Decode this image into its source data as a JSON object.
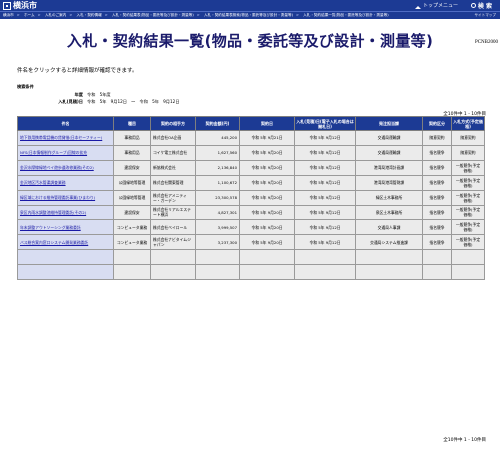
{
  "header": {
    "logo_text": "横浜市",
    "menu_label": "トップメニュー",
    "search_label": "検 索",
    "breadcrumb": [
      "横浜市",
      "ホーム",
      "入札のご案内",
      "入札・契約情報",
      "入札・契約結果表(物品・委託等及び設計・測量等)",
      "入札・契約結果表検索(物品・委託等及び設計・測量等)",
      "入札・契約結果一覧(物品・委託等及び設計・測量等)"
    ],
    "sitemap_label": "サイトマップ"
  },
  "page": {
    "title": "入札・契約結果一覧(物品・委託等及び設計・測量等)",
    "id": "PCNB2000",
    "hint": "件名をクリックすると詳細情報が確認できます。"
  },
  "conditions": {
    "title": "検索条件",
    "rows": [
      {
        "label": "年度",
        "value": "令和　5年度"
      },
      {
        "label": "入札(見積)日",
        "value": "令和　5年　9月12日　～　令和　5年　9月12日"
      }
    ]
  },
  "count_label": "全10件中 1 - 10件目",
  "table": {
    "headers": [
      "件名",
      "種目",
      "契約の相手方",
      "契約金額(円)",
      "契約日",
      "入札(見積)日(電子入札の場合は開札日)",
      "発注担当課",
      "契約区分",
      "入札方式(予定価格)"
    ],
    "rows": [
      {
        "name": "地下鉄用携帯電話機の賃貸借(日本セーフティー)",
        "category": "事務用品",
        "party": "株式会社OA企画",
        "amount": "445,200",
        "contract_date": "令和 5年 9月21日",
        "bid_date": "令和 5年 9月12日",
        "dept": "交通局運輸課",
        "kind": "随意契約",
        "method": "随意契約"
      },
      {
        "name": "NFS(日本情報制作グループ)回線の拡充",
        "category": "事務用品",
        "party": "コイケ電工株式会社",
        "amount": "1,627,560",
        "contract_date": "令和 5年 9月20日",
        "bid_date": "令和 5年 9月12日",
        "dept": "交通局運輸課",
        "kind": "指名競争",
        "method": "随意契約"
      },
      {
        "name": "金沢水際線緑地ベイ遊歩道改修業務(その2)",
        "category": "建設保安",
        "party": "新協株式会社",
        "amount": "2,136,840",
        "contract_date": "令和 5年 9月20日",
        "bid_date": "令和 5年 9月12日",
        "dept": "港湾局港湾計画課",
        "kind": "指名競争",
        "method": "一般競争(予定価格)"
      },
      {
        "name": "金沢地区汚水管渠調査業務",
        "category": "公園緑地等管理",
        "party": "株式会社関東管理",
        "amount": "1,100,672",
        "contract_date": "令和 5年 9月20日",
        "bid_date": "令和 5年 9月12日",
        "dept": "港湾局港湾管財課",
        "kind": "指名競争",
        "method": "一般競争(予定価格)"
      },
      {
        "name": "緑区域における維持管理委託事業(ひまわり)",
        "category": "公園緑地等管理",
        "party": "株式会社アメニティー・ガーデン",
        "amount": "23,300,578",
        "contract_date": "令和 5年 9月20日",
        "bid_date": "令和 5年 9月12日",
        "dept": "緑区土木事務所",
        "kind": "指名競争",
        "method": "一般競争(予定価格)"
      },
      {
        "name": "泉区内雨水調整池維持管理委託(その2)",
        "category": "建設保安",
        "party": "株式会社リアルエステート横浜",
        "amount": "4,827,301",
        "contract_date": "令和 5年 9月20日",
        "bid_date": "令和 5年 9月12日",
        "dept": "泉区土木事務所",
        "kind": "指名競争",
        "method": "一般競争(予定価格)"
      },
      {
        "name": "年末調整アウトソーシング業務委託",
        "category": "コンピュータ業務",
        "party": "株式会社ベイロール",
        "amount": "3,999,507",
        "contract_date": "令和 5年 9月20日",
        "bid_date": "令和 5年 9月12日",
        "dept": "交通局人事課",
        "kind": "指名競争",
        "method": "一般競争(予定価格)"
      },
      {
        "name": "バス総合案内窓口システム開発業務委託",
        "category": "コンピュータ業務",
        "party": "株式会社ナビタイムジャパン",
        "amount": "3,237,300",
        "contract_date": "令和 5年 9月20日",
        "bid_date": "令和 5年 9月12日",
        "dept": "交通局システム推進課",
        "kind": "指名競争",
        "method": "一般競争(予定価格)"
      },
      {
        "name": "",
        "category": "",
        "party": "",
        "amount": "",
        "contract_date": "",
        "bid_date": "",
        "dept": "",
        "kind": "",
        "method": ""
      },
      {
        "name": "",
        "category": "",
        "party": "",
        "amount": "",
        "contract_date": "",
        "bid_date": "",
        "dept": "",
        "kind": "",
        "method": ""
      }
    ]
  }
}
